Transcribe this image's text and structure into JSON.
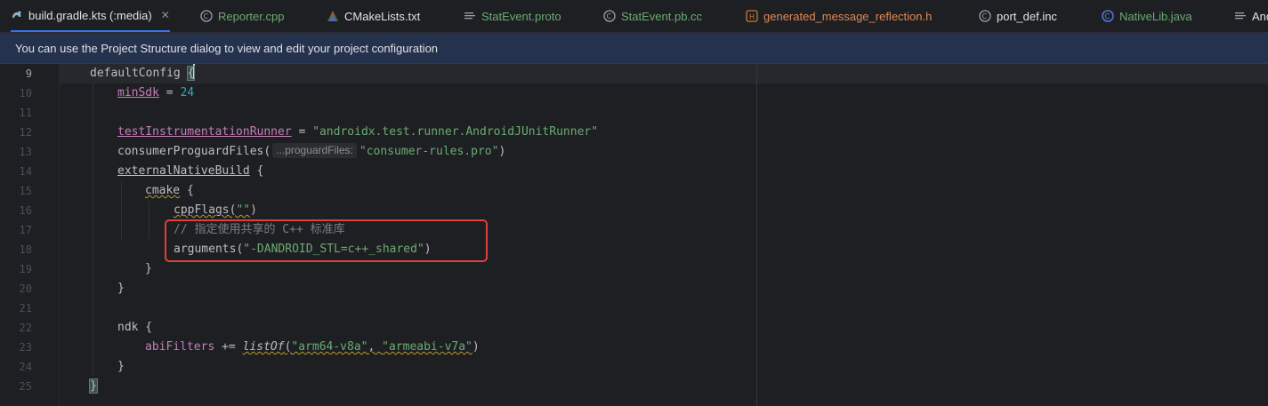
{
  "tabs": [
    {
      "label": "build.gradle.kts (:media)",
      "icon": "gradle-icon",
      "active": true
    },
    {
      "label": "Reporter.cpp",
      "icon": "cpp-file-icon"
    },
    {
      "label": "CMakeLists.txt",
      "icon": "cmake-icon"
    },
    {
      "label": "StatEvent.proto",
      "icon": "text-file-icon"
    },
    {
      "label": "StatEvent.pb.cc",
      "icon": "cpp-file-icon"
    },
    {
      "label": "generated_message_reflection.h",
      "icon": "header-file-icon"
    },
    {
      "label": "port_def.inc",
      "icon": "cpp-file-icon"
    },
    {
      "label": "NativeLib.java",
      "icon": "java-class-icon"
    },
    {
      "label": "And",
      "icon": "text-file-icon"
    }
  ],
  "banner": {
    "text": "You can use the Project Structure dialog to view and edit your project configuration"
  },
  "editor": {
    "line_numbers": [
      "9",
      "10",
      "11",
      "12",
      "13",
      "14",
      "15",
      "16",
      "17",
      "18",
      "19",
      "20",
      "21",
      "22",
      "23",
      "24",
      "25"
    ],
    "current_line": "9",
    "code": {
      "l9_a": "defaultConfig ",
      "l9_b": "{",
      "l10_a": "minSdk",
      "l10_b": " = ",
      "l10_c": "24",
      "l12_a": "testInstrumentationRunner",
      "l12_b": " = ",
      "l12_c": "\"androidx.test.runner.AndroidJUnitRunner\"",
      "l13_a": "consumerProguardFiles(",
      "l13_hint": "...proguardFiles:",
      "l13_b": "\"consumer-rules.pro\"",
      "l13_c": ")",
      "l14_a": "externalNativeBuild",
      "l14_b": " {",
      "l15_a": "cmake",
      "l15_b": " {",
      "l16_a": "cppFlags(",
      "l16_b": "\"\"",
      "l16_c": ")",
      "l17": "// 指定使用共享的 C++ 标准库",
      "l18_a": "arguments(",
      "l18_b": "\"-DANDROID_STL=c++_shared\"",
      "l18_c": ")",
      "l19": "}",
      "l20": "}",
      "l22_a": "ndk",
      "l22_b": " {",
      "l23_a": "abiFilters",
      "l23_b": " += ",
      "l23_c": "listOf",
      "l23_d": "(",
      "l23_e": "\"arm64-v8a\"",
      "l23_f": ", ",
      "l23_g": "\"armeabi-v7a\"",
      "l23_h": ")",
      "l24": "}",
      "l25": "}"
    }
  },
  "colors": {
    "accent": "#3574f0",
    "banner_bg": "#25324d",
    "highlight_box": "#e0403a"
  }
}
